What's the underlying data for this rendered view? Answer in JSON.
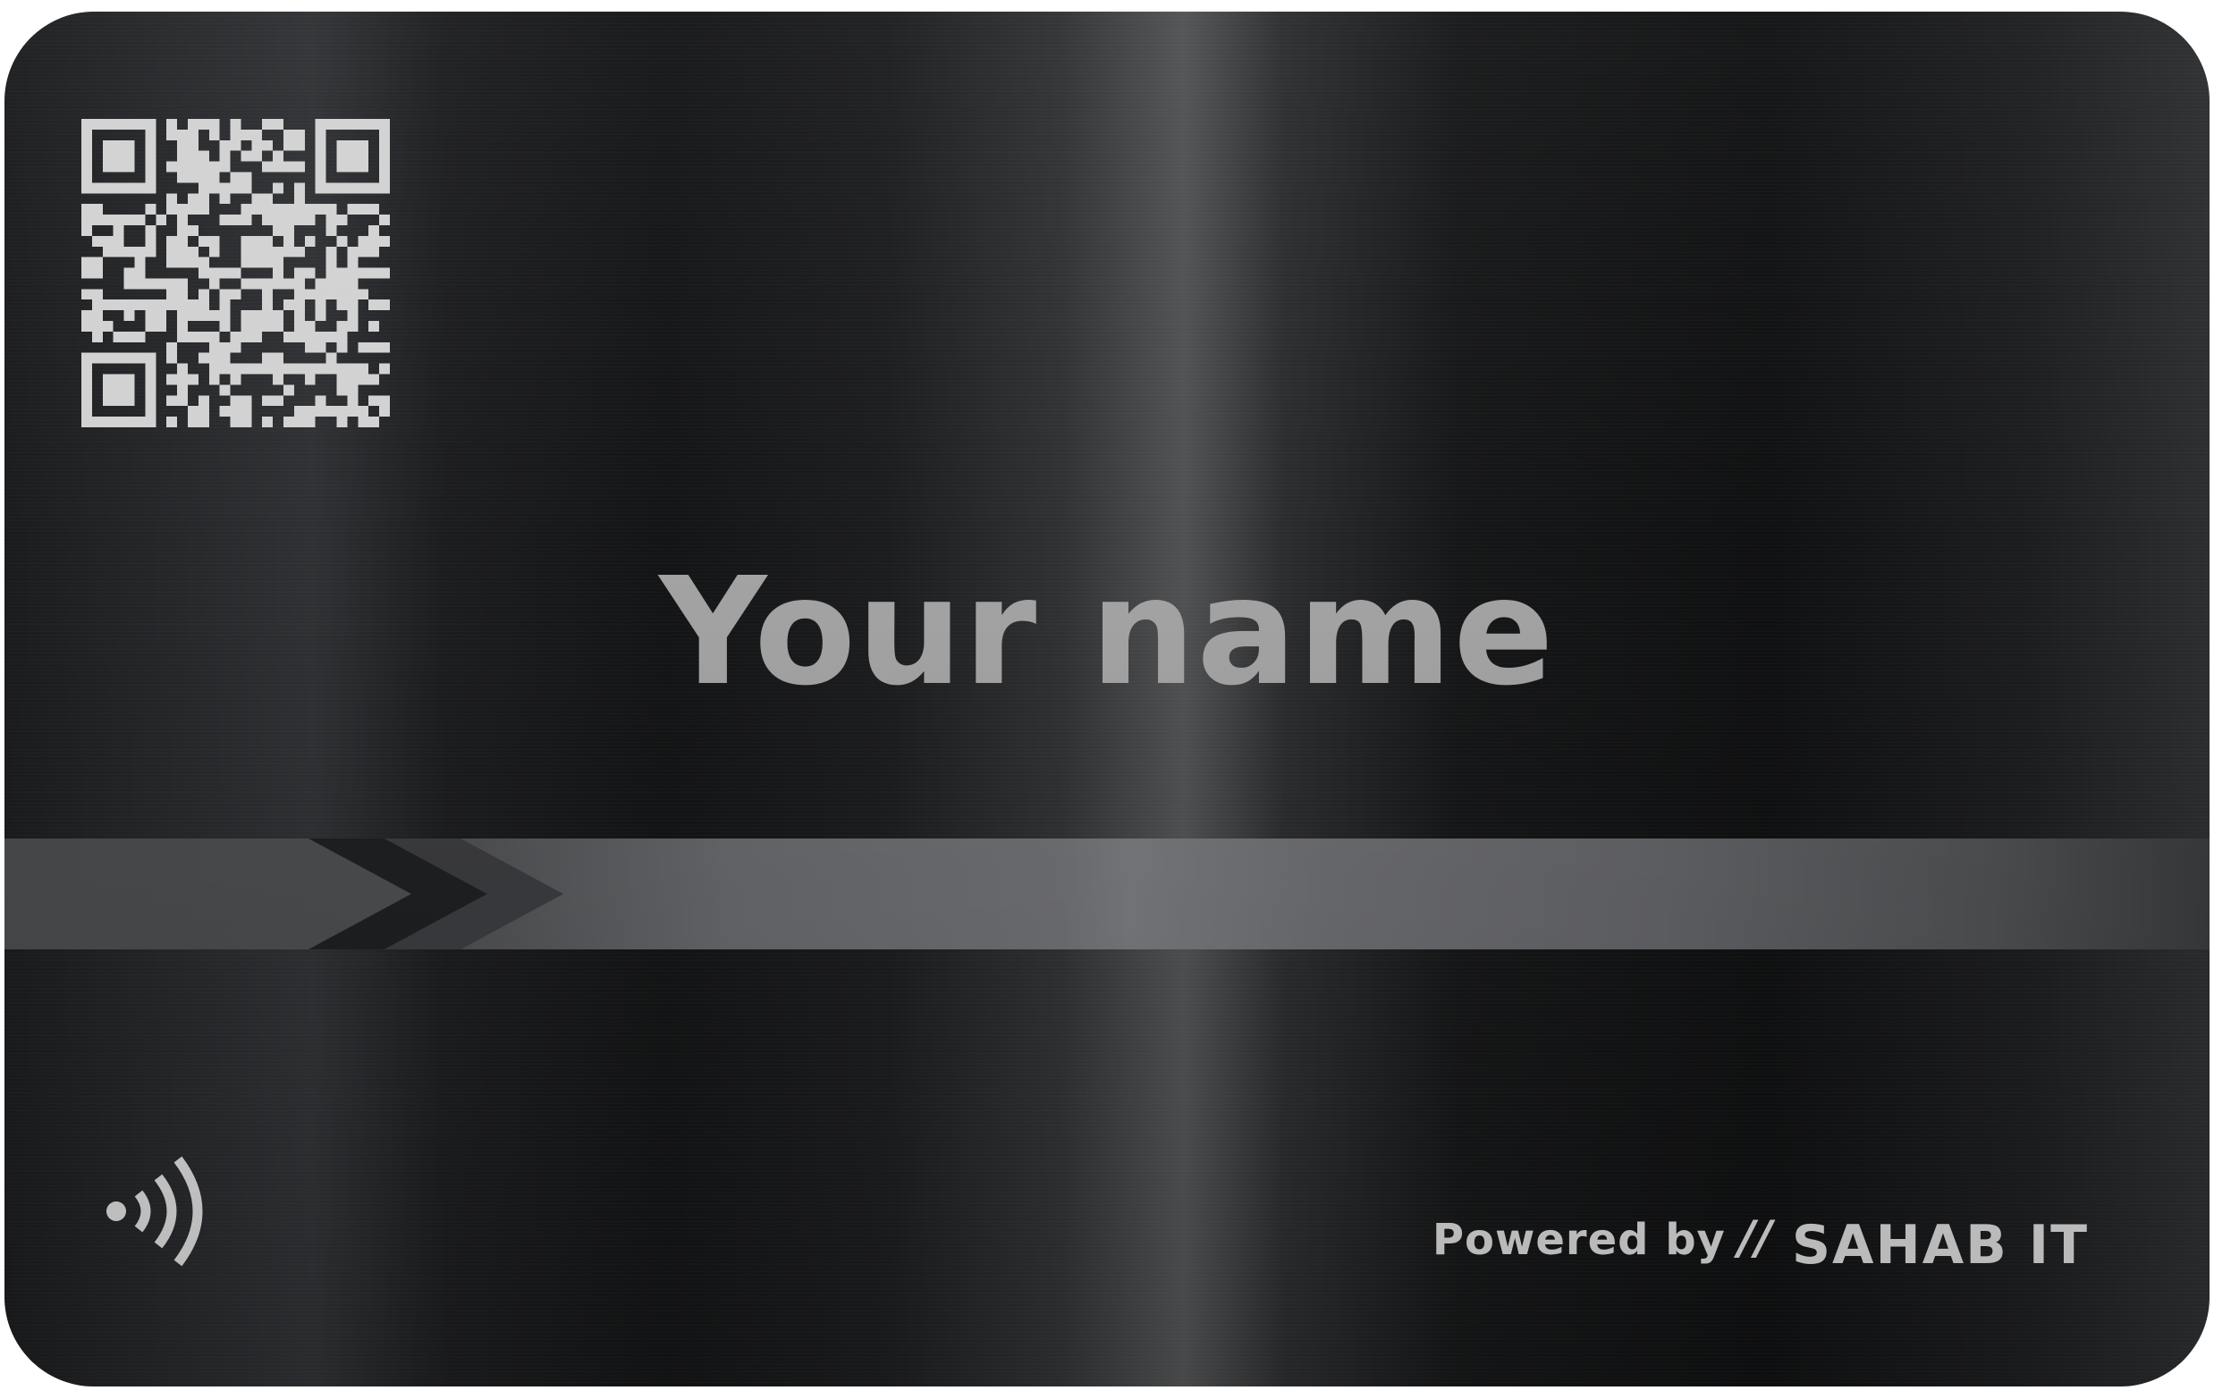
{
  "card": {
    "name": "Your name",
    "powered_by": "Powered by",
    "separator": "//",
    "brand": "SAHAB IT"
  },
  "icons": {
    "qr": "qr-code-icon",
    "contactless": "nfc-contactless-icon",
    "chevrons": "chevron-right-icon"
  },
  "colors": {
    "card_base": "#151617",
    "name_text": "#a3a3a3",
    "footer_text": "#cfcfcf",
    "qr_modules": "#d2d2d2",
    "stripe": "#6d6e72"
  }
}
